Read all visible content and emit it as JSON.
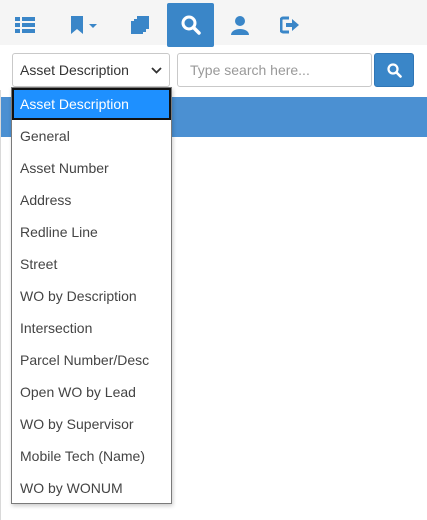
{
  "toolbar": {
    "buttons": [
      {
        "icon": "list-icon"
      },
      {
        "icon": "bookmark-dropdown-icon"
      },
      {
        "icon": "copy-icon"
      },
      {
        "icon": "search-icon",
        "active": true
      },
      {
        "icon": "user-icon"
      },
      {
        "icon": "sign-out-icon"
      }
    ]
  },
  "search": {
    "selected_field": "Asset Description",
    "placeholder": "Type search here...",
    "options": [
      "Asset Description",
      "General",
      "Asset Number",
      "Address",
      "Redline Line",
      "Street",
      "WO by Description",
      "Intersection",
      "Parcel Number/Desc",
      "Open WO by Lead",
      "WO by Supervisor",
      "Mobile Tech (Name)",
      "WO by WONUM"
    ]
  },
  "colors": {
    "accent": "#3a86c8",
    "header_bar": "#4b90d2",
    "selected_option": "#1e90ff"
  }
}
